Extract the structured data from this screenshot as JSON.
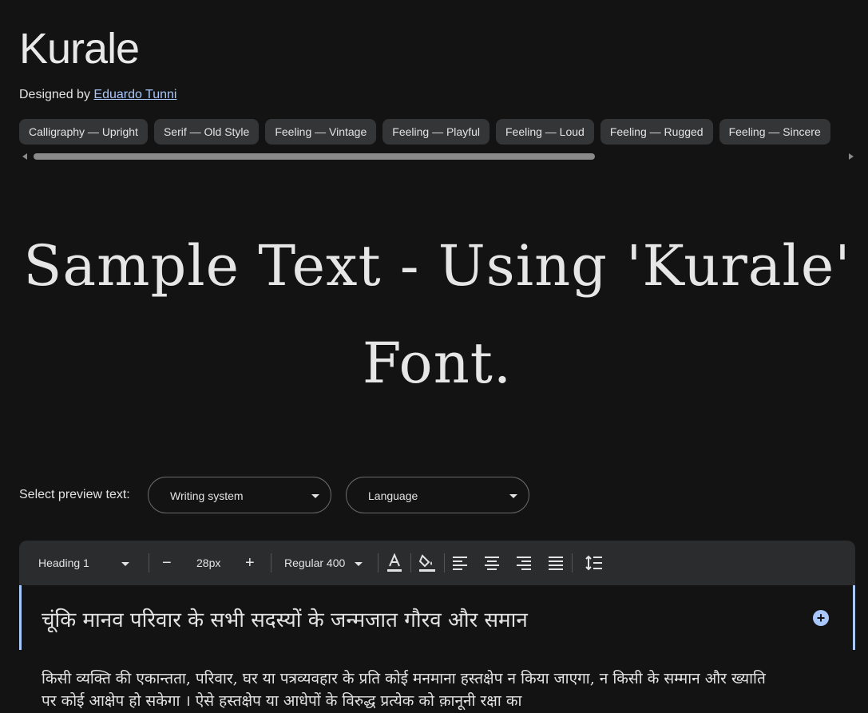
{
  "font": {
    "name": "Kurale",
    "designed_by_label": "Designed by",
    "designer": "Eduardo Tunni"
  },
  "tags": [
    "Calligraphy — Upright",
    "Serif — Old Style",
    "Feeling — Vintage",
    "Feeling — Playful",
    "Feeling — Loud",
    "Feeling — Rugged",
    "Feeling — Sincere"
  ],
  "sample_text": "Sample Text - Using 'Kurale' Font.",
  "preview": {
    "label": "Select preview text:",
    "writing_system": "Writing system",
    "language": "Language"
  },
  "toolbar": {
    "style": "Heading 1",
    "minus": "−",
    "size": "28px",
    "plus": "+",
    "weight": "Regular 400"
  },
  "editor": {
    "heading": "चूंकि मानव परिवार के सभी सदस्यों के जन्मजात गौरव और समान",
    "paragraph": "किसी व्यक्ति की एकान्तता, परिवार, घर या पत्रव्यवहार के प्रति कोई मनमाना हस्तक्षेप न किया जाएगा, न किसी के सम्मान और ख्याति पर कोई आक्षेप हो सकेगा । ऐसे हस्तक्षेप या आधेपों के विरुद्ध प्रत्येक को क़ानूनी रक्षा का"
  },
  "colors": {
    "background": "#131313",
    "accent": "#a8c7fa",
    "chip": "#333537",
    "toolbar": "#2b2c2e"
  }
}
